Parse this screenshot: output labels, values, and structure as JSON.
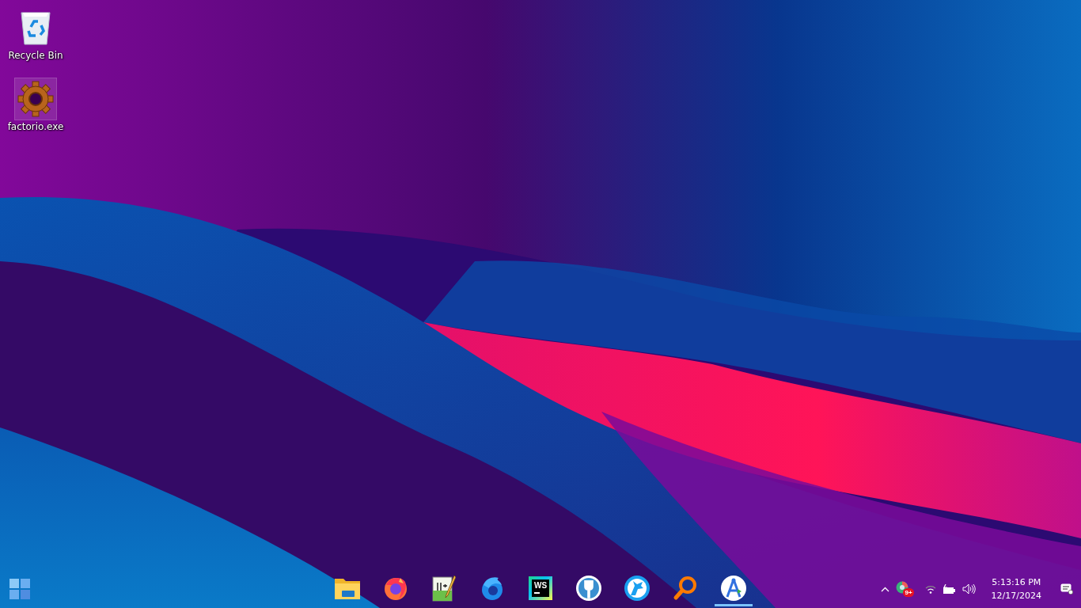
{
  "desktop_icons": [
    {
      "label": "Recycle Bin",
      "kind": "recycle-bin",
      "selected": false
    },
    {
      "label": "factorio.exe",
      "kind": "gear",
      "selected": true
    }
  ],
  "taskbar": {
    "apps": [
      {
        "kind": "folder",
        "selected": false
      },
      {
        "kind": "fox-globe",
        "selected": false
      },
      {
        "kind": "notepad",
        "selected": false
      },
      {
        "kind": "bird-globe",
        "selected": false
      },
      {
        "kind": "ws-logo",
        "text": "WS",
        "selected": false
      },
      {
        "kind": "fork",
        "selected": false
      },
      {
        "kind": "wolf",
        "selected": false
      },
      {
        "kind": "magnifier",
        "selected": false
      },
      {
        "kind": "compass",
        "selected": true
      }
    ],
    "tray": {
      "badge": "9+"
    },
    "clock": {
      "time": "5:13:16 PM",
      "date": "12/17/2024"
    }
  }
}
